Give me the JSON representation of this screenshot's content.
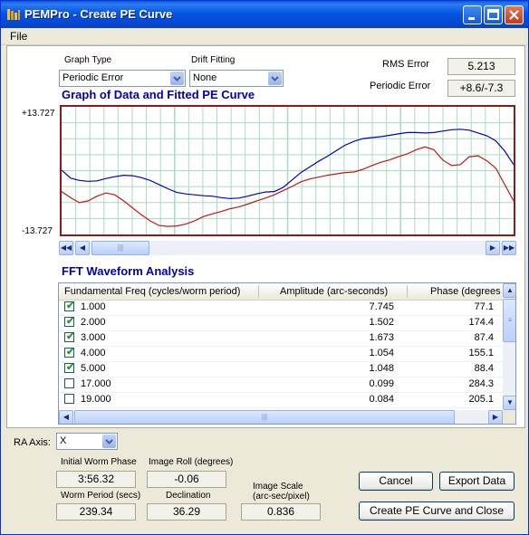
{
  "window": {
    "title": "PEMPro - Create PE Curve"
  },
  "menu": {
    "file": "File"
  },
  "graph_type": {
    "label": "Graph Type",
    "value": "Periodic Error"
  },
  "drift_fitting": {
    "label": "Drift Fitting",
    "value": "None"
  },
  "rms_error": {
    "label": "RMS Error",
    "value": "5.213"
  },
  "periodic_error": {
    "label": "Periodic Error",
    "value": "+8.6/-7.3"
  },
  "graph": {
    "title": "Graph of Data and Fitted PE Curve",
    "ymax_label": "+13.727",
    "ymin_label": "-13.727",
    "colors": {
      "fitted": "#0000c8",
      "data": "#c81414",
      "grid": "#a8dcc0",
      "border": "#8b1a1a"
    }
  },
  "chart_data": {
    "type": "line",
    "ylim": [
      -13.727,
      13.727
    ],
    "series": [
      {
        "values": [
          0.1,
          -1.6,
          -2.1,
          -2.3,
          -2.2,
          -1.7,
          -1.3,
          -1.0,
          -1.1,
          -1.5,
          -2.1,
          -3.0,
          -3.9,
          -4.7,
          -5.0,
          -5.2,
          -5.4,
          -5.5,
          -5.8,
          -6.0,
          -5.9,
          -5.5,
          -5.0,
          -4.6,
          -4.5,
          -3.6,
          -2.0,
          -0.4,
          0.8,
          2.0,
          3.1,
          4.3,
          5.5,
          6.3,
          6.9,
          7.1,
          7.3,
          7.6,
          7.9,
          8.2,
          8.2,
          8.1,
          8.2,
          8.5,
          8.8,
          8.9,
          8.7,
          8.1,
          7.5,
          6.4,
          4.2,
          1.3
        ]
      },
      {
        "values": [
          -4.5,
          -5.8,
          -6.9,
          -6.5,
          -5.5,
          -4.8,
          -5.2,
          -6.5,
          -8.0,
          -9.5,
          -10.8,
          -11.8,
          -12.0,
          -11.9,
          -11.5,
          -10.8,
          -9.9,
          -9.3,
          -8.8,
          -8.2,
          -7.8,
          -7.2,
          -6.5,
          -5.9,
          -5.2,
          -4.3,
          -3.4,
          -2.4,
          -1.8,
          -1.4,
          -1.0,
          -0.7,
          -0.4,
          -0.3,
          0.3,
          1.1,
          1.8,
          2.3,
          3.0,
          3.6,
          4.5,
          5.1,
          4.5,
          2.3,
          1.1,
          1.3,
          3.0,
          3.2,
          2.1,
          0.5,
          -3.0,
          -6.5
        ]
      }
    ]
  },
  "fft": {
    "title": "FFT Waveform Analysis",
    "columns": [
      "Fundamental Freq (cycles/worm period)",
      "Amplitude (arc-seconds)",
      "Phase (degrees"
    ],
    "rows": [
      {
        "checked": true,
        "freq": "1.000",
        "amp": "7.745",
        "phase": "77.1"
      },
      {
        "checked": true,
        "freq": "2.000",
        "amp": "1.502",
        "phase": "174.4"
      },
      {
        "checked": true,
        "freq": "3.000",
        "amp": "1.673",
        "phase": "87.4"
      },
      {
        "checked": true,
        "freq": "4.000",
        "amp": "1.054",
        "phase": "155.1"
      },
      {
        "checked": true,
        "freq": "5.000",
        "amp": "1.048",
        "phase": "88.4"
      },
      {
        "checked": false,
        "freq": "17.000",
        "amp": "0.099",
        "phase": "284.3"
      },
      {
        "checked": false,
        "freq": "19.000",
        "amp": "0.084",
        "phase": "205.1"
      }
    ]
  },
  "ra_axis": {
    "label": "RA Axis:",
    "value": "X"
  },
  "fields": {
    "initial_worm_phase": {
      "label": "Initial Worm Phase",
      "value": "3:56.32"
    },
    "image_roll": {
      "label": "Image Roll (degrees)",
      "value": "-0.06"
    },
    "worm_period": {
      "label": "Worm Period (secs)",
      "value": "239.34"
    },
    "declination": {
      "label": "Declination",
      "value": "36.29"
    },
    "image_scale": {
      "label1": "Image Scale",
      "label2": "(arc-sec/pixel)",
      "value": "0.836"
    }
  },
  "buttons": {
    "cancel": "Cancel",
    "export": "Export Data",
    "create": "Create PE Curve and Close"
  }
}
